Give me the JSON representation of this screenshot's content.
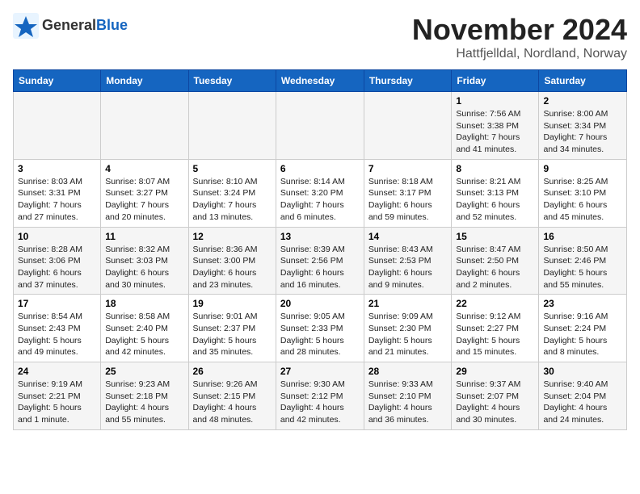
{
  "header": {
    "logo_general": "General",
    "logo_blue": "Blue",
    "month": "November 2024",
    "location": "Hattfjelldal, Nordland, Norway"
  },
  "weekdays": [
    "Sunday",
    "Monday",
    "Tuesday",
    "Wednesday",
    "Thursday",
    "Friday",
    "Saturday"
  ],
  "weeks": [
    [
      {
        "day": "",
        "info": ""
      },
      {
        "day": "",
        "info": ""
      },
      {
        "day": "",
        "info": ""
      },
      {
        "day": "",
        "info": ""
      },
      {
        "day": "",
        "info": ""
      },
      {
        "day": "1",
        "info": "Sunrise: 7:56 AM\nSunset: 3:38 PM\nDaylight: 7 hours\nand 41 minutes."
      },
      {
        "day": "2",
        "info": "Sunrise: 8:00 AM\nSunset: 3:34 PM\nDaylight: 7 hours\nand 34 minutes."
      }
    ],
    [
      {
        "day": "3",
        "info": "Sunrise: 8:03 AM\nSunset: 3:31 PM\nDaylight: 7 hours\nand 27 minutes."
      },
      {
        "day": "4",
        "info": "Sunrise: 8:07 AM\nSunset: 3:27 PM\nDaylight: 7 hours\nand 20 minutes."
      },
      {
        "day": "5",
        "info": "Sunrise: 8:10 AM\nSunset: 3:24 PM\nDaylight: 7 hours\nand 13 minutes."
      },
      {
        "day": "6",
        "info": "Sunrise: 8:14 AM\nSunset: 3:20 PM\nDaylight: 7 hours\nand 6 minutes."
      },
      {
        "day": "7",
        "info": "Sunrise: 8:18 AM\nSunset: 3:17 PM\nDaylight: 6 hours\nand 59 minutes."
      },
      {
        "day": "8",
        "info": "Sunrise: 8:21 AM\nSunset: 3:13 PM\nDaylight: 6 hours\nand 52 minutes."
      },
      {
        "day": "9",
        "info": "Sunrise: 8:25 AM\nSunset: 3:10 PM\nDaylight: 6 hours\nand 45 minutes."
      }
    ],
    [
      {
        "day": "10",
        "info": "Sunrise: 8:28 AM\nSunset: 3:06 PM\nDaylight: 6 hours\nand 37 minutes."
      },
      {
        "day": "11",
        "info": "Sunrise: 8:32 AM\nSunset: 3:03 PM\nDaylight: 6 hours\nand 30 minutes."
      },
      {
        "day": "12",
        "info": "Sunrise: 8:36 AM\nSunset: 3:00 PM\nDaylight: 6 hours\nand 23 minutes."
      },
      {
        "day": "13",
        "info": "Sunrise: 8:39 AM\nSunset: 2:56 PM\nDaylight: 6 hours\nand 16 minutes."
      },
      {
        "day": "14",
        "info": "Sunrise: 8:43 AM\nSunset: 2:53 PM\nDaylight: 6 hours\nand 9 minutes."
      },
      {
        "day": "15",
        "info": "Sunrise: 8:47 AM\nSunset: 2:50 PM\nDaylight: 6 hours\nand 2 minutes."
      },
      {
        "day": "16",
        "info": "Sunrise: 8:50 AM\nSunset: 2:46 PM\nDaylight: 5 hours\nand 55 minutes."
      }
    ],
    [
      {
        "day": "17",
        "info": "Sunrise: 8:54 AM\nSunset: 2:43 PM\nDaylight: 5 hours\nand 49 minutes."
      },
      {
        "day": "18",
        "info": "Sunrise: 8:58 AM\nSunset: 2:40 PM\nDaylight: 5 hours\nand 42 minutes."
      },
      {
        "day": "19",
        "info": "Sunrise: 9:01 AM\nSunset: 2:37 PM\nDaylight: 5 hours\nand 35 minutes."
      },
      {
        "day": "20",
        "info": "Sunrise: 9:05 AM\nSunset: 2:33 PM\nDaylight: 5 hours\nand 28 minutes."
      },
      {
        "day": "21",
        "info": "Sunrise: 9:09 AM\nSunset: 2:30 PM\nDaylight: 5 hours\nand 21 minutes."
      },
      {
        "day": "22",
        "info": "Sunrise: 9:12 AM\nSunset: 2:27 PM\nDaylight: 5 hours\nand 15 minutes."
      },
      {
        "day": "23",
        "info": "Sunrise: 9:16 AM\nSunset: 2:24 PM\nDaylight: 5 hours\nand 8 minutes."
      }
    ],
    [
      {
        "day": "24",
        "info": "Sunrise: 9:19 AM\nSunset: 2:21 PM\nDaylight: 5 hours\nand 1 minute."
      },
      {
        "day": "25",
        "info": "Sunrise: 9:23 AM\nSunset: 2:18 PM\nDaylight: 4 hours\nand 55 minutes."
      },
      {
        "day": "26",
        "info": "Sunrise: 9:26 AM\nSunset: 2:15 PM\nDaylight: 4 hours\nand 48 minutes."
      },
      {
        "day": "27",
        "info": "Sunrise: 9:30 AM\nSunset: 2:12 PM\nDaylight: 4 hours\nand 42 minutes."
      },
      {
        "day": "28",
        "info": "Sunrise: 9:33 AM\nSunset: 2:10 PM\nDaylight: 4 hours\nand 36 minutes."
      },
      {
        "day": "29",
        "info": "Sunrise: 9:37 AM\nSunset: 2:07 PM\nDaylight: 4 hours\nand 30 minutes."
      },
      {
        "day": "30",
        "info": "Sunrise: 9:40 AM\nSunset: 2:04 PM\nDaylight: 4 hours\nand 24 minutes."
      }
    ]
  ]
}
